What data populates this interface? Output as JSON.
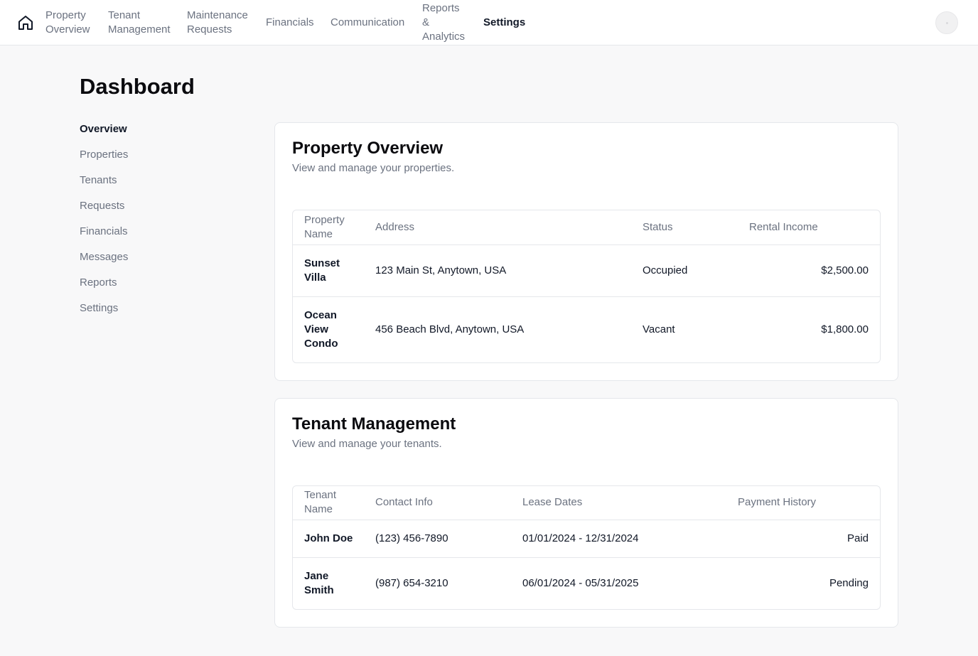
{
  "nav": {
    "items": [
      {
        "label": "Property Overview"
      },
      {
        "label": "Tenant Management"
      },
      {
        "label": "Maintenance Requests"
      },
      {
        "label": "Financials"
      },
      {
        "label": "Communication"
      },
      {
        "label": "Reports & Analytics"
      },
      {
        "label": "Settings",
        "active": true
      }
    ],
    "home_icon": "home-icon",
    "avatar_icon": "user-avatar"
  },
  "page": {
    "title": "Dashboard"
  },
  "sidebar": {
    "items": [
      {
        "label": "Overview",
        "active": true
      },
      {
        "label": "Properties"
      },
      {
        "label": "Tenants"
      },
      {
        "label": "Requests"
      },
      {
        "label": "Financials"
      },
      {
        "label": "Messages"
      },
      {
        "label": "Reports"
      },
      {
        "label": "Settings"
      }
    ]
  },
  "property_card": {
    "title": "Property Overview",
    "subtitle": "View and manage your properties.",
    "headers": [
      "Property Name",
      "Address",
      "Status",
      "Rental Income"
    ],
    "rows": [
      {
        "name": "Sunset Villa",
        "address": "123 Main St, Anytown, USA",
        "status": "Occupied",
        "income": "$2,500.00"
      },
      {
        "name": "Ocean View Condo",
        "address": "456 Beach Blvd, Anytown, USA",
        "status": "Vacant",
        "income": "$1,800.00"
      }
    ]
  },
  "tenant_card": {
    "title": "Tenant Management",
    "subtitle": "View and manage your tenants.",
    "headers": [
      "Tenant Name",
      "Contact Info",
      "Lease Dates",
      "Payment History"
    ],
    "rows": [
      {
        "name": "John Doe",
        "contact": "(123) 456-7890",
        "lease": "01/01/2024 - 12/31/2024",
        "payment": "Paid"
      },
      {
        "name": "Jane Smith",
        "contact": "(987) 654-3210",
        "lease": "06/01/2024 - 05/31/2025",
        "payment": "Pending"
      }
    ]
  },
  "colors": {
    "accent": "#111827",
    "muted": "#6b7280",
    "border": "#e5e7eb",
    "background": "#f8f8f9"
  }
}
